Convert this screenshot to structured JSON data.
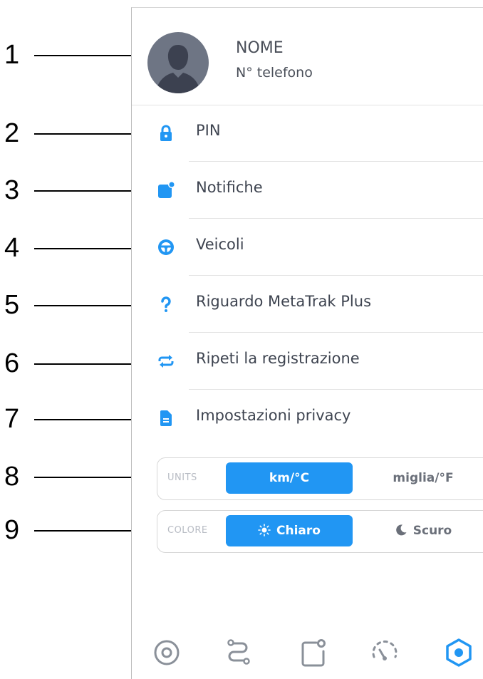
{
  "callouts": [
    "1",
    "2",
    "3",
    "4",
    "5",
    "6",
    "7",
    "8",
    "9"
  ],
  "profile": {
    "name": "NOME",
    "phone": "N° telefono",
    "avatar_icon": "user-silhouette-icon"
  },
  "menu": [
    {
      "label": "PIN",
      "icon": "lock-icon"
    },
    {
      "label": "Notifiche",
      "icon": "notification-icon"
    },
    {
      "label": "Veicoli",
      "icon": "steering-wheel-icon"
    },
    {
      "label": "Riguardo MetaTrak Plus",
      "icon": "question-icon"
    },
    {
      "label": "Ripeti la registrazione",
      "icon": "repeat-icon"
    },
    {
      "label": "Impostazioni privacy",
      "icon": "document-icon"
    }
  ],
  "units": {
    "caption": "UNITS",
    "option1": "km/°C",
    "option2": "miglia/°F",
    "selected": "km/°C"
  },
  "theme": {
    "caption": "COLORE",
    "option1": "Chiaro",
    "option2": "Scuro",
    "selected": "Chiaro"
  },
  "tabbar": [
    {
      "icon": "target-icon"
    },
    {
      "icon": "route-icon"
    },
    {
      "icon": "notification-square-icon"
    },
    {
      "icon": "speedometer-icon"
    },
    {
      "icon": "settings-hexagon-icon",
      "active": true
    }
  ],
  "colors": {
    "accent": "#2196f3",
    "text": "#3e4450",
    "avatar": "#6e7584",
    "inactive_icon": "#8a9099"
  }
}
